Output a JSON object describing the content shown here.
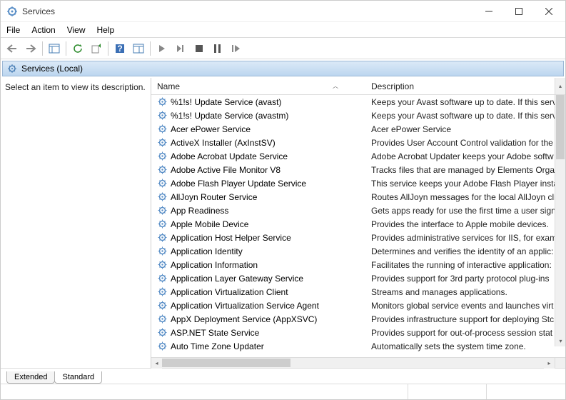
{
  "window": {
    "title": "Services"
  },
  "menu": {
    "file": "File",
    "action": "Action",
    "view": "View",
    "help": "Help"
  },
  "category": "Services (Local)",
  "hint": "Select an item to view its description.",
  "columns": {
    "name": "Name",
    "description": "Description"
  },
  "tabs": {
    "extended": "Extended",
    "standard": "Standard"
  },
  "services": [
    {
      "name": "%1!s! Update Service (avast)",
      "desc": "Keeps your Avast software up to date. If this serv"
    },
    {
      "name": "%1!s! Update Service (avastm)",
      "desc": "Keeps your Avast software up to date. If this serv"
    },
    {
      "name": "Acer ePower Service",
      "desc": "Acer ePower Service"
    },
    {
      "name": "ActiveX Installer (AxInstSV)",
      "desc": "Provides User Account Control validation for the"
    },
    {
      "name": "Adobe Acrobat Update Service",
      "desc": "Adobe Acrobat Updater keeps your Adobe softw"
    },
    {
      "name": "Adobe Active File Monitor V8",
      "desc": "Tracks files that are managed by Elements Orgar"
    },
    {
      "name": "Adobe Flash Player Update Service",
      "desc": "This service keeps your Adobe Flash Player insta"
    },
    {
      "name": "AllJoyn Router Service",
      "desc": "Routes AllJoyn messages for the local AllJoyn cli"
    },
    {
      "name": "App Readiness",
      "desc": "Gets apps ready for use the first time a user sign:"
    },
    {
      "name": "Apple Mobile Device",
      "desc": "Provides the interface to Apple mobile devices."
    },
    {
      "name": "Application Host Helper Service",
      "desc": "Provides administrative services for IIS, for exam"
    },
    {
      "name": "Application Identity",
      "desc": "Determines and verifies the identity of an applic:"
    },
    {
      "name": "Application Information",
      "desc": "Facilitates the running of interactive application:"
    },
    {
      "name": "Application Layer Gateway Service",
      "desc": "Provides support for 3rd party protocol plug-ins"
    },
    {
      "name": "Application Virtualization Client",
      "desc": "Streams and manages applications."
    },
    {
      "name": "Application Virtualization Service Agent",
      "desc": "Monitors global service events and launches virt"
    },
    {
      "name": "AppX Deployment Service (AppXSVC)",
      "desc": "Provides infrastructure support for deploying Stc"
    },
    {
      "name": "ASP.NET State Service",
      "desc": "Provides support for out-of-process session stat"
    },
    {
      "name": "Auto Time Zone Updater",
      "desc": "Automatically sets the system time zone."
    }
  ]
}
